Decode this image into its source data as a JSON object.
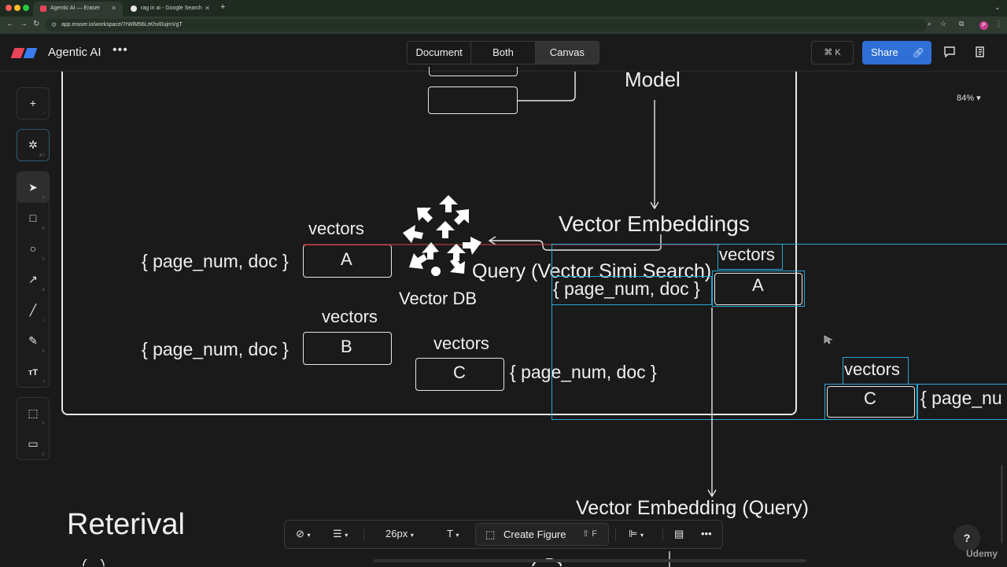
{
  "browser": {
    "tabs": [
      {
        "label": "Agentic AI — Eraser",
        "active": true
      },
      {
        "label": "rag in ai - Google Search",
        "active": false
      }
    ],
    "url": "app.eraser.io/workspace/7rWlM56LrKhvl0ujmVgT",
    "profile_initial": "P"
  },
  "header": {
    "title": "Agentic AI",
    "view_tabs": [
      "Document",
      "Both",
      "Canvas"
    ],
    "active_view": "Canvas",
    "command_shortcut": "⌘ K",
    "share_label": "Share"
  },
  "toolbar": {
    "shortcuts": {
      "add": "/",
      "ai": "⌘J",
      "select": "V",
      "rectangle": "R",
      "ellipse": "O",
      "arrow": "A",
      "line": "L",
      "pen": "D",
      "text": "T",
      "frame": "F",
      "comment": "C"
    }
  },
  "zoom": "84%",
  "canvas": {
    "model_label": "Model",
    "vector_embeddings_label": "Vector Embeddings",
    "query_label": "Query (Vector Simi Search)",
    "vector_db_label": "Vector DB",
    "vectors_label": "vectors",
    "meta_label": "{ page_num, doc }",
    "box_a": "A",
    "box_b": "B",
    "box_c": "C",
    "selected_meta_label": "{ page_nu",
    "vector_embedding_query_label": "Vector Embedding (Query)",
    "retrieval_title": "Reterival"
  },
  "bottom_toolbar": {
    "font_size": "26px",
    "text_tool": "T",
    "create_figure_label": "Create Figure",
    "create_figure_shortcut": "⇧ F"
  },
  "help_label": "?",
  "watermark": "Udemy",
  "colors": {
    "accent": "#2f6fd6",
    "selection": "#2aa6d6",
    "background": "#1a1a1a",
    "stroke": "#e6e6e6"
  }
}
